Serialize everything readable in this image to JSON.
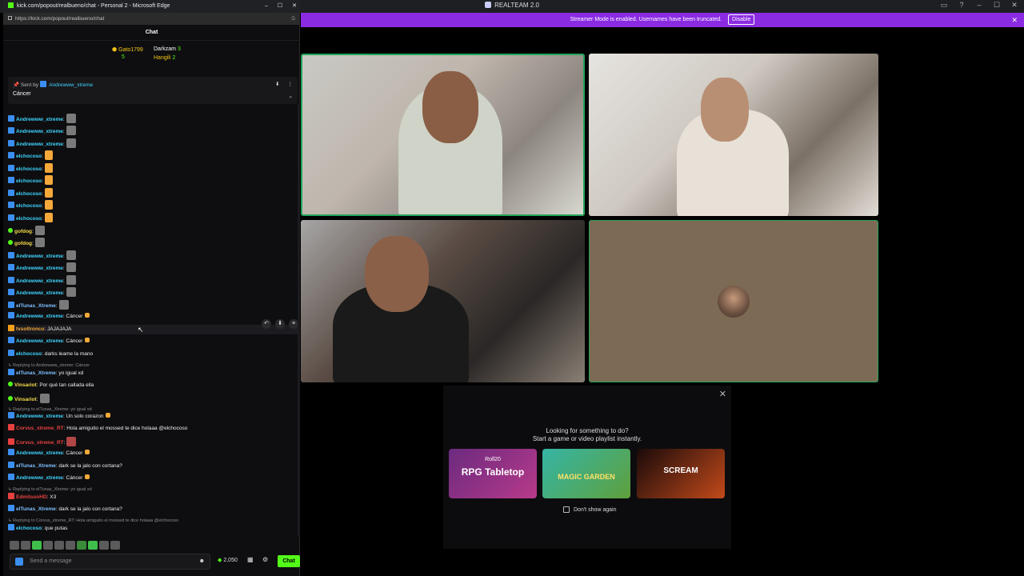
{
  "app": {
    "title": "REALTEAM 2.0",
    "banner_text": "Streamer Mode is enabled. Usernames have been truncated.",
    "banner_button": "Disable",
    "activity": {
      "title_line1": "Looking for something to do?",
      "title_line2": "Start a game or video playlist instantly.",
      "cards": [
        {
          "sub": "Roll20",
          "label": "RPG Tabletop"
        },
        {
          "sub": "",
          "label": "MAGIC GARDEN"
        },
        {
          "sub": "",
          "label": "SCREAM"
        }
      ],
      "dont_show": "Don't show again"
    }
  },
  "browser": {
    "title": "kick.com/popout/realbueno/chat - Personal 2 - Microsoft Edge",
    "url": "https://kick.com/popout/realbueno/chat",
    "chat_header": "Chat",
    "leaderboard": {
      "first_name": "Gato1799",
      "first_count": "5",
      "second_name": "Darkzam",
      "second_count": "3",
      "third_name": "Hangili",
      "third_count": "2"
    },
    "pinned": {
      "sent_by_label": "Sent by",
      "sent_by_user": "Andrewww_xtreme",
      "message": "Cáncer"
    },
    "chat_lines": [
      {
        "user": "Andrewww_xtreme",
        "text": ":"
      },
      {
        "user": "Andrewww_xtreme",
        "text": ":"
      },
      {
        "user": "Andrewww_xtreme",
        "text": ":"
      },
      {
        "user": "elchocoso",
        "text": ":"
      },
      {
        "user": "elchocoso",
        "text": ":"
      },
      {
        "user": "elchocoso",
        "text": ":"
      },
      {
        "user": "elchocoso",
        "text": ":"
      },
      {
        "user": "elchocoso",
        "text": ":"
      },
      {
        "user": "elchocoso",
        "text": ":"
      },
      {
        "user": "gofdog",
        "text": ":"
      },
      {
        "user": "gofdog",
        "text": ":"
      },
      {
        "user": "Andrewww_xtreme",
        "text": ":"
      },
      {
        "user": "Andrewww_xtreme",
        "text": ":"
      },
      {
        "user": "Andrewww_xtreme",
        "text": ":"
      },
      {
        "user": "Andrewww_xtreme",
        "text": ":"
      },
      {
        "user": "elTunas_Xtreme",
        "text": ":"
      },
      {
        "user": "Andrewww_xtreme",
        "text": ": Cáncer"
      },
      {
        "user": "tvsoltronco",
        "text": ": JAJAJAJA"
      },
      {
        "user": "Andrewww_xtreme",
        "text": ": Cáncer"
      },
      {
        "user": "elchocoso",
        "text": ": darks leame la mano"
      },
      {
        "reply": "Replying to Andrewww_xtreme: Cáncer"
      },
      {
        "user": "elTunas_Xtreme",
        "text": ": yo igual xd"
      },
      {
        "user": "Vinsariot",
        "text": ": Por qué tan callada ella"
      },
      {
        "user": "Vinsariot",
        "text": ":"
      },
      {
        "reply": "Replying to elTunas_Xtreme: yo igual xd"
      },
      {
        "user": "Andrewww_xtreme",
        "text": ": Un solo corazon"
      },
      {
        "user": "Corvus_xtreme_RT",
        "text": ": Hola amiguito el mossed te dice holaaa @elchocoso"
      },
      {
        "user": "Corvus_xtreme_RT",
        "text": ":"
      },
      {
        "user": "Andrewww_xtreme",
        "text": ": Cáncer"
      },
      {
        "user": "elTunas_Xtreme",
        "text": ": dark se la jalo con cortana?"
      },
      {
        "user": "Andrewww_xtreme",
        "text": ": Cáncer"
      },
      {
        "reply": "Replying to elTunas_Xtreme: yo igual xd"
      },
      {
        "user": "EdmilsonHD",
        "text": ": X3"
      },
      {
        "user": "elTunas_Xtreme",
        "text": ": dark se la jalo con cortana?"
      },
      {
        "reply": "Replying to Corvus_xtreme_RT: Hola amiguito el mossed te dice holaaa @elchocoso"
      },
      {
        "user": "elchocoso",
        "text": ": que putas"
      }
    ],
    "input_placeholder": "Send a message",
    "points": "2,050",
    "send_label": "Chat"
  },
  "icons": [
    "kick-icon",
    "lock-icon",
    "pin-icon",
    "more-icon",
    "chevron-down-icon",
    "reply-icon",
    "settings-icon",
    "gift-icon",
    "emote-icon",
    "close-icon"
  ],
  "colors": {
    "kick_green": "#53fc18",
    "discord_speaking": "#23a55a",
    "banner_purple": "#8a2be2"
  }
}
